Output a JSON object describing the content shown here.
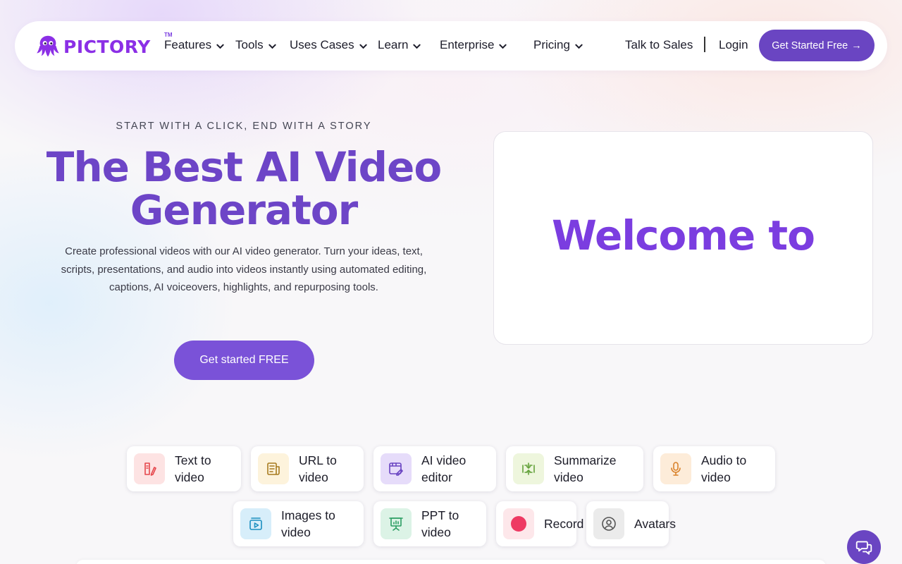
{
  "nav": {
    "logo_text": "PICTORY",
    "logo_tm": "TM",
    "menu": [
      {
        "label": "Features"
      },
      {
        "label": "Tools"
      },
      {
        "label": "Uses Cases"
      },
      {
        "label": "Learn"
      },
      {
        "label": "Enterprise"
      },
      {
        "label": "Pricing"
      }
    ],
    "talk_to_sales": "Talk to Sales",
    "login": "Login",
    "cta": "Get Started Free",
    "cta_arrow": "→"
  },
  "hero": {
    "eyebrow": "START WITH A CLICK, END WITH A STORY",
    "headline_line1": "The Best AI Video",
    "headline_line2": "Generator",
    "description": "Create professional videos with our AI video generator. Turn your ideas, text, scripts, presentations, and audio into videos instantly using automated editing, captions, AI voiceovers, highlights, and repurposing tools.",
    "cta": "Get started FREE"
  },
  "video_preview": {
    "text": "Welcome to"
  },
  "features": [
    {
      "label": "Text to\nvideo",
      "icon": "text-edit-icon",
      "bg": "#fde3e3",
      "color": "#e5484d"
    },
    {
      "label": "URL to\nvideo",
      "icon": "document-icon",
      "bg": "#fdf3dc",
      "color": "#a77b1f"
    },
    {
      "label": "AI video\neditor",
      "icon": "video-edit-icon",
      "bg": "#e6dcfa",
      "color": "#6a45c2"
    },
    {
      "label": "Summarize\nvideo",
      "icon": "compress-icon",
      "bg": "#eef6dd",
      "color": "#62a13a"
    },
    {
      "label": "Audio to\nvideo",
      "icon": "microphone-icon",
      "bg": "#fdecd9",
      "color": "#d9822b"
    },
    {
      "label": "Images to\nvideo",
      "icon": "image-play-icon",
      "bg": "#d7eefa",
      "color": "#1b8fc0"
    },
    {
      "label": "PPT to\nvideo",
      "icon": "presentation-icon",
      "bg": "#dcf3e6",
      "color": "#2a9d62"
    },
    {
      "label": "Record",
      "icon": "record-icon",
      "bg": "#fde7ea",
      "color": "#ee3a63"
    },
    {
      "label": "Avatars",
      "icon": "avatar-icon",
      "bg": "#ebebeb",
      "color": "#555555"
    }
  ],
  "colors": {
    "brand": "#6a45c2",
    "headline": "#6d45c7",
    "logo": "#8b2fe6"
  }
}
